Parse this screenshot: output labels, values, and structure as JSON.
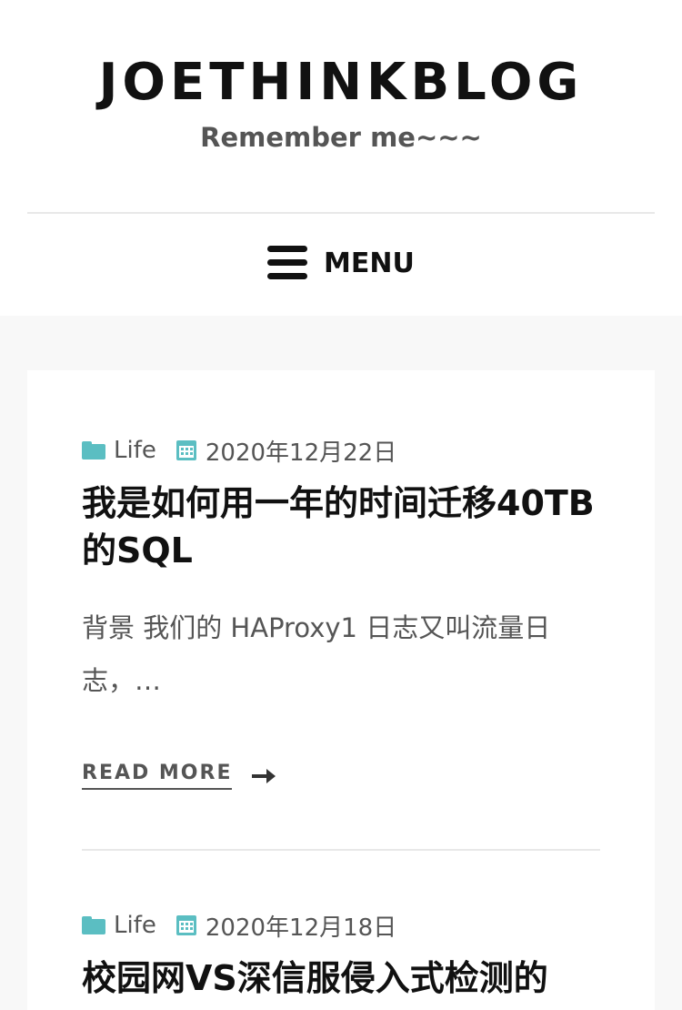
{
  "header": {
    "site_title": "JOETHINKBLOG",
    "site_description": "Remember me~~~",
    "menu_label": "MENU"
  },
  "colors": {
    "accent": "#5bbec2",
    "background": "#f8f8f8",
    "card": "#ffffff",
    "text": "#111111",
    "muted": "#555555"
  },
  "posts": [
    {
      "category": "Life",
      "date": "2020年12月22日",
      "title": "我是如何用一年的时间迁移40TB的SQL",
      "excerpt": "背景 我们的 HAProxy1 日志又叫流量日志，…",
      "read_more": "READ MORE"
    },
    {
      "category": "Life",
      "date": "2020年12月18日",
      "title": "校园网VS深信服侵入式检测的"
    }
  ]
}
